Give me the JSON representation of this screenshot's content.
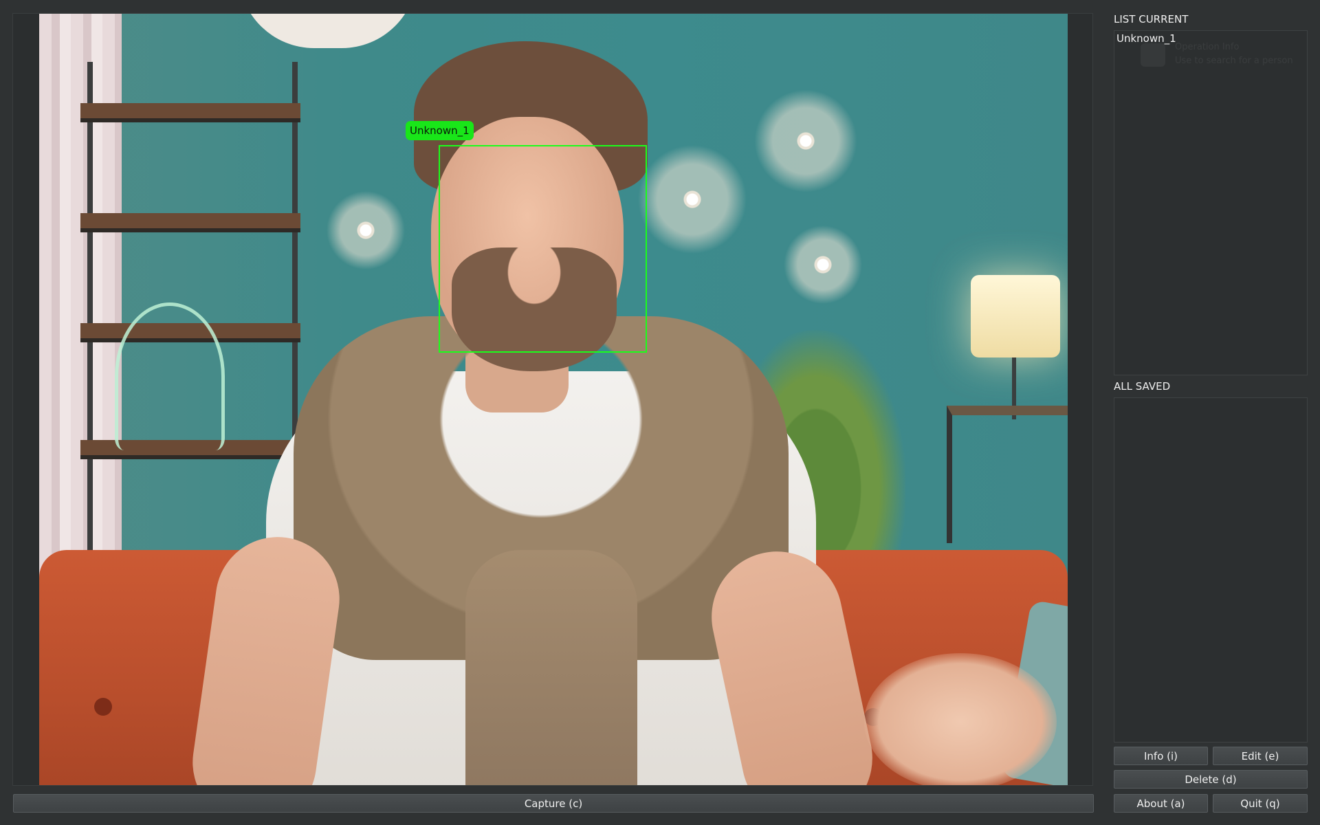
{
  "video": {
    "detected_face_label": "Unknown_1",
    "overlay_color": "#1aff1a"
  },
  "capture_button": {
    "label": "Capture (c)"
  },
  "list_current": {
    "title": "LIST CURRENT",
    "items": [
      "Unknown_1"
    ],
    "ghost_lines": [
      "Operation Info",
      "Use to search for a person"
    ]
  },
  "all_saved": {
    "title": "ALL SAVED",
    "items": []
  },
  "buttons": {
    "info": "Info (i)",
    "edit": "Edit (e)",
    "delete": "Delete (d)",
    "about": "About (a)",
    "quit": "Quit (q)"
  },
  "colors": {
    "background": "#2f3233",
    "button": "#44484a",
    "accent": "#1aff1a"
  }
}
